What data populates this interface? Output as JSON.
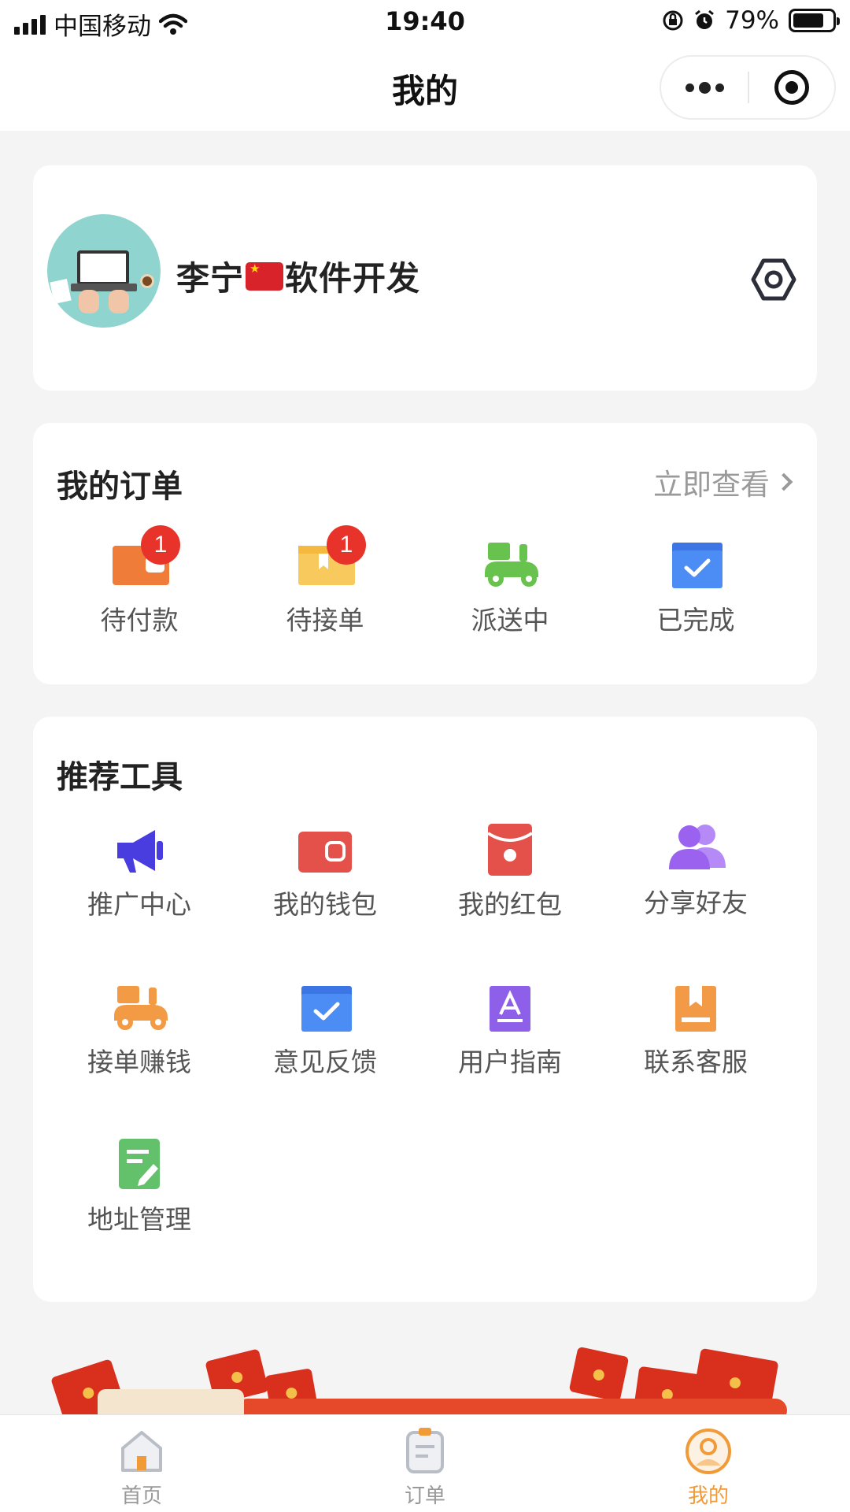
{
  "status_bar": {
    "carrier": "中国移动",
    "time": "19:40",
    "battery": "79%",
    "battery_level": 0.79,
    "icons": [
      "signal-icon",
      "wifi-icon",
      "orientation-lock-icon",
      "alarm-icon",
      "battery-icon"
    ]
  },
  "nav": {
    "title": "我的",
    "icons": [
      "more-icon",
      "target-icon"
    ]
  },
  "profile": {
    "name_prefix": "李宁",
    "name_suffix": "软件开发",
    "icons": [
      "avatar",
      "china-flag-icon",
      "settings-icon"
    ]
  },
  "orders": {
    "title": "我的订单",
    "view_all": "立即查看",
    "items": [
      {
        "label": "待付款",
        "icon": "wallet-icon",
        "badge": "1"
      },
      {
        "label": "待接单",
        "icon": "package-icon",
        "badge": "1"
      },
      {
        "label": "派送中",
        "icon": "scooter-icon"
      },
      {
        "label": "已完成",
        "icon": "completed-box-icon"
      }
    ]
  },
  "tools": {
    "title": "推荐工具",
    "items": [
      {
        "label": "推广中心",
        "icon": "megaphone-icon"
      },
      {
        "label": "我的钱包",
        "icon": "wallet-icon"
      },
      {
        "label": "我的红包",
        "icon": "red-packet-icon"
      },
      {
        "label": "分享好友",
        "icon": "users-icon"
      },
      {
        "label": "接单赚钱",
        "icon": "scooter-icon"
      },
      {
        "label": "意见反馈",
        "icon": "feedback-box-icon"
      },
      {
        "label": "用户指南",
        "icon": "guide-icon"
      },
      {
        "label": "联系客服",
        "icon": "service-book-icon"
      },
      {
        "label": "地址管理",
        "icon": "address-edit-icon"
      }
    ]
  },
  "tabbar": {
    "items": [
      {
        "label": "首页",
        "icon": "home-icon"
      },
      {
        "label": "订单",
        "icon": "orders-icon"
      },
      {
        "label": "我的",
        "icon": "profile-icon",
        "active": true
      }
    ]
  },
  "colors": {
    "accent": "#f19a38",
    "badge": "#e8332b",
    "orange": "#f07c3a",
    "yellow": "#f8c95c",
    "green": "#68c34e",
    "blue": "#4b8cf5",
    "purple": "#9b62f0",
    "indigo": "#4a3de0",
    "red": "#e4504a"
  }
}
